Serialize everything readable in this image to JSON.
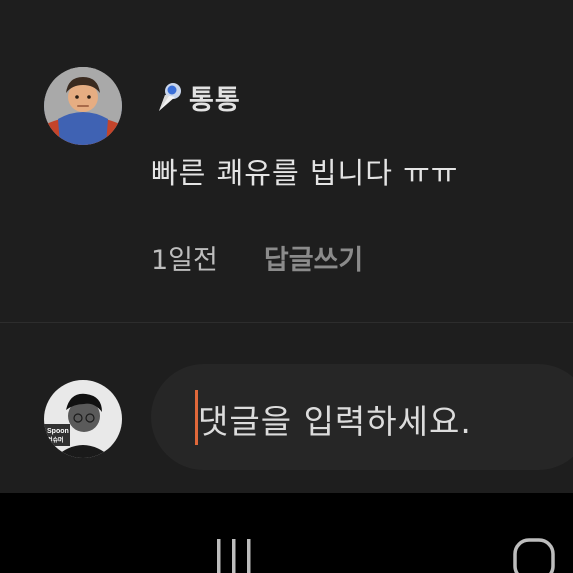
{
  "comment": {
    "username": "통통",
    "badge_icon": "ice-cream-cone-icon",
    "text": "빠른 쾌유를 빕니다 ㅠㅠ",
    "time": "1일전",
    "reply_label": "답글쓰기"
  },
  "input": {
    "placeholder": "댓글을 입력하세요.",
    "avatar_caption_1": "Spoon",
    "avatar_caption_2": "컨슈머"
  },
  "nav": {
    "recent_icon": "recent-apps-icon",
    "home_icon": "home-icon"
  },
  "colors": {
    "background": "#1e1e1e",
    "caret": "#e0683a",
    "input_background": "#262626",
    "nav_background": "#000000"
  }
}
